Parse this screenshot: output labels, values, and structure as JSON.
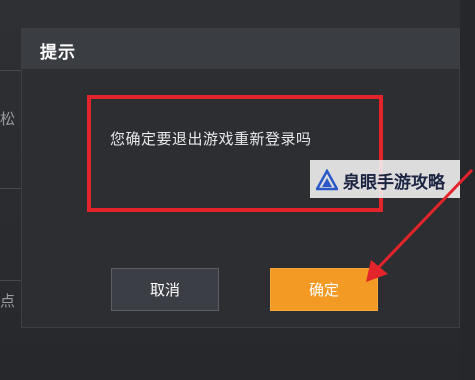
{
  "background": {
    "left_fragments": [
      "松",
      "点"
    ]
  },
  "dialog": {
    "title": "提示",
    "message": "您确定要退出游戏重新登录吗",
    "cancel_label": "取消",
    "confirm_label": "确定"
  },
  "watermark": {
    "text": "泉眼手游攻略",
    "logo_icon": "triangle-logo-icon"
  },
  "colors": {
    "accent_orange": "#f39a24",
    "highlight_red": "#e3242b",
    "dialog_bg": "#2c2e32",
    "header_bg": "#3a3d42"
  }
}
